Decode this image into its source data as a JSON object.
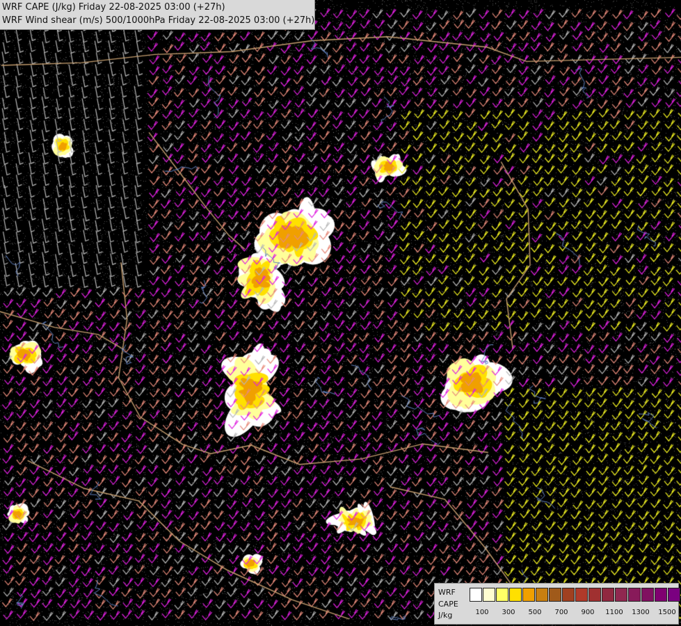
{
  "header": {
    "title_line1": "WRF CAPE (J/kg) Friday 22-08-2025 03:00 (+27h)",
    "title_line2": "WRF Wind shear (m/s) 500/1000hPa Friday 22-08-2025 03:00 (+27h)"
  },
  "legend": {
    "model": "WRF",
    "field": "CAPE",
    "unit": "J/kg",
    "colors": [
      "#ffffff",
      "#fffdd0",
      "#ffff66",
      "#ffe000",
      "#f0a000",
      "#c87f10",
      "#a05a1a",
      "#a04020",
      "#b03a2a",
      "#a03030",
      "#902840",
      "#902850",
      "#881a5a",
      "#801060",
      "#800070",
      "#7a0080"
    ],
    "tick_labels": [
      "100",
      "300",
      "500",
      "700",
      "900",
      "1100",
      "1300",
      "1500"
    ]
  },
  "palette": {
    "background": "#000000",
    "stipple": "#e0e0e0",
    "barb_gray": "#b8b8b8",
    "barb_salmon": "#e88a7a",
    "barb_magenta": "#e020e0",
    "barb_yellow": "#f0f020",
    "border": "#c8a070",
    "river": "#6080c0",
    "cape_colors": [
      "#ffffff",
      "#ffff99",
      "#ffe000",
      "#f0a000"
    ]
  }
}
